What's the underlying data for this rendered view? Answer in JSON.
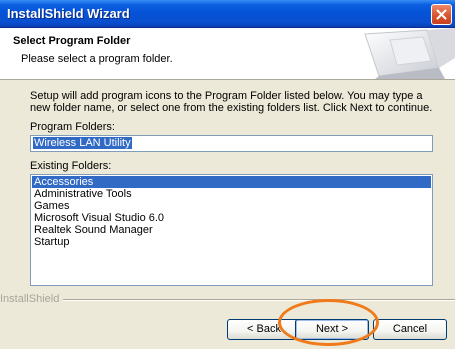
{
  "window": {
    "title": "InstallShield Wizard"
  },
  "header": {
    "title": "Select Program Folder",
    "subtitle": "Please select a program folder."
  },
  "body": {
    "description": "Setup will add program icons to the Program Folder listed below.  You may type a new folder name, or select one from the existing folders list.  Click Next to continue.",
    "program_folders_label": "Program Folders:",
    "program_folder_value": "Wireless LAN Utility",
    "existing_folders_label": "Existing Folders:",
    "existing_folders": [
      "Accessories",
      "Administrative Tools",
      "Games",
      "Microsoft Visual Studio 6.0",
      "Realtek Sound Manager",
      "Startup"
    ],
    "selected_folder": "Accessories"
  },
  "footer": {
    "brand": "InstallShield",
    "back_label": "< Back",
    "next_label": "Next >",
    "cancel_label": "Cancel"
  },
  "colors": {
    "titlebar": "#0552d6",
    "selection": "#316ac5",
    "highlight_ring": "#f07a1a"
  }
}
